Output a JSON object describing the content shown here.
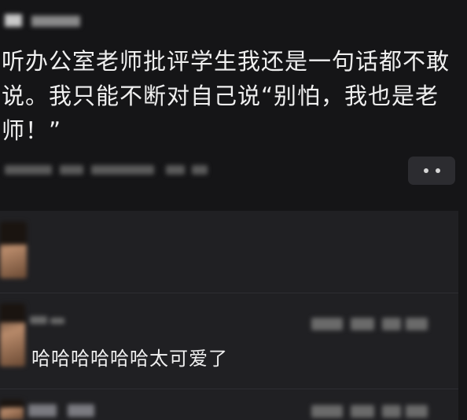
{
  "post": {
    "text": "听办公室老师批评学生我还是一句话都不敢说。我只能不断对自己说“别怕，我也是老师！”"
  },
  "more_button": {
    "icon": "more-dots-icon"
  },
  "comments": [
    {
      "text": ""
    },
    {
      "text": "哈哈哈哈哈哈太可爱了"
    },
    {
      "text": ""
    }
  ]
}
